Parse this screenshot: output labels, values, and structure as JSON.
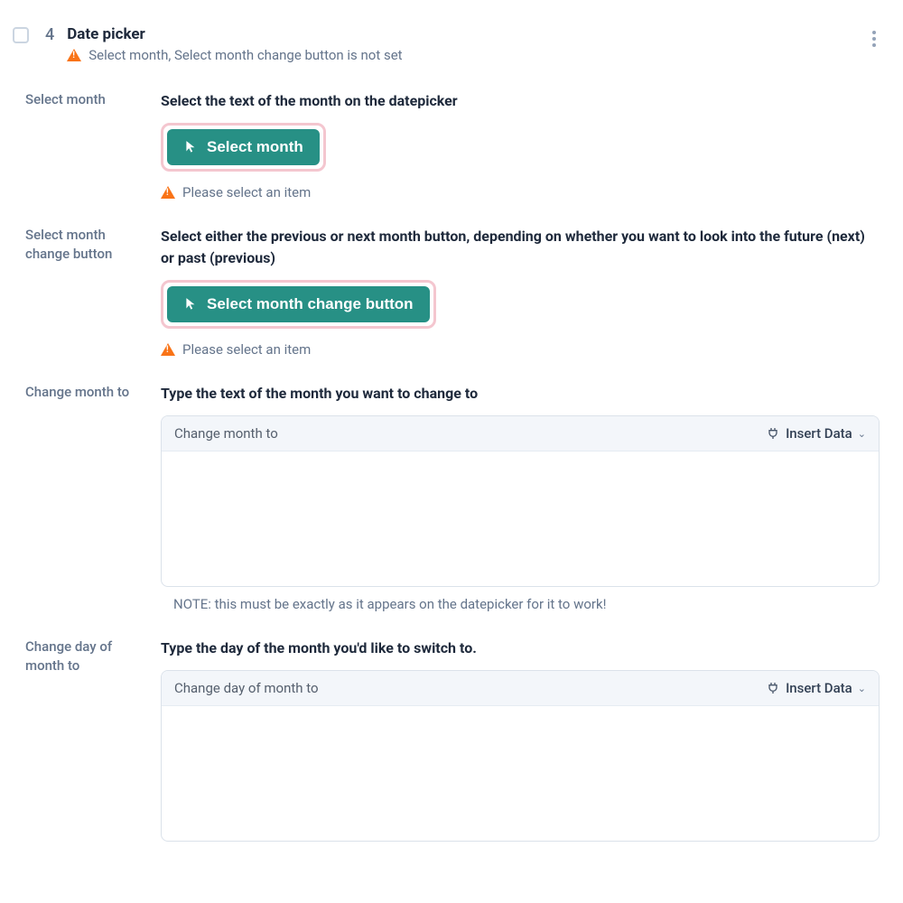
{
  "header": {
    "step_number": "4",
    "title": "Date picker",
    "warning": "Select month, Select month change button is not set"
  },
  "sections": {
    "select_month": {
      "label": "Select month",
      "description": "Select the text of the month on the datepicker",
      "button_label": "Select month",
      "warning": "Please select an item"
    },
    "select_month_change": {
      "label": "Select month change button",
      "description": "Select either the previous or next month button, depending on whether you want to look into the future (next) or past (previous)",
      "button_label": "Select month change button",
      "warning": "Please select an item"
    },
    "change_month_to": {
      "label": "Change month to",
      "description": "Type the text of the month you want to change to",
      "placeholder": "Change month to",
      "insert_label": "Insert Data",
      "note": "NOTE: this must be exactly as it appears on the datepicker for it to work!"
    },
    "change_day_to": {
      "label": "Change day of month to",
      "description": "Type the day of the month you'd like to switch to.",
      "placeholder": "Change day of month to",
      "insert_label": "Insert Data"
    }
  }
}
